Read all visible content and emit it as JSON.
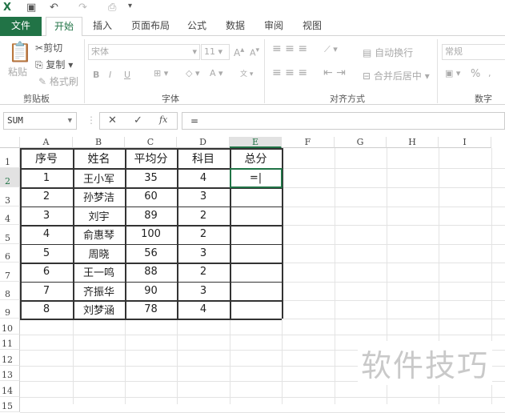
{
  "qat": {
    "undo": "↶",
    "redo": "↷"
  },
  "tabs": [
    "文件",
    "开始",
    "插入",
    "页面布局",
    "公式",
    "数据",
    "审阅",
    "视图"
  ],
  "ribbon": {
    "clipboard": {
      "paste": "粘贴",
      "cut": "剪切",
      "copy": "复制",
      "format_painter": "格式刷",
      "label": "剪贴板"
    },
    "font": {
      "name": "宋体",
      "size": "11",
      "bold": "B",
      "italic": "I",
      "underline": "U",
      "label": "字体"
    },
    "alignment": {
      "wrap": "自动换行",
      "merge": "合并后居中",
      "label": "对齐方式"
    },
    "number": {
      "format": "常规",
      "percent": "%",
      "label": "数字"
    }
  },
  "formula_bar": {
    "name_box": "SUM",
    "cancel": "✕",
    "enter": "✓",
    "fx": "fx",
    "formula": "="
  },
  "columns": [
    "A",
    "B",
    "C",
    "D",
    "E",
    "F",
    "G",
    "H",
    "I"
  ],
  "rows": [
    "1",
    "2",
    "3",
    "4",
    "5",
    "6",
    "7",
    "8",
    "9",
    "10",
    "11",
    "12",
    "13",
    "14",
    "15"
  ],
  "table": {
    "headers": [
      "序号",
      "姓名",
      "平均分",
      "科目",
      "总分"
    ],
    "rows": [
      [
        "1",
        "王小军",
        "35",
        "4",
        "=|"
      ],
      [
        "2",
        "孙梦洁",
        "60",
        "3",
        ""
      ],
      [
        "3",
        "刘宇",
        "89",
        "2",
        ""
      ],
      [
        "4",
        "俞惠琴",
        "100",
        "2",
        ""
      ],
      [
        "5",
        "周晓",
        "56",
        "3",
        ""
      ],
      [
        "6",
        "王一鸣",
        "88",
        "2",
        ""
      ],
      [
        "7",
        "齐振华",
        "90",
        "3",
        ""
      ],
      [
        "8",
        "刘梦涵",
        "78",
        "4",
        ""
      ]
    ]
  },
  "watermark": "软件技巧",
  "colors": {
    "accent": "#217346"
  }
}
